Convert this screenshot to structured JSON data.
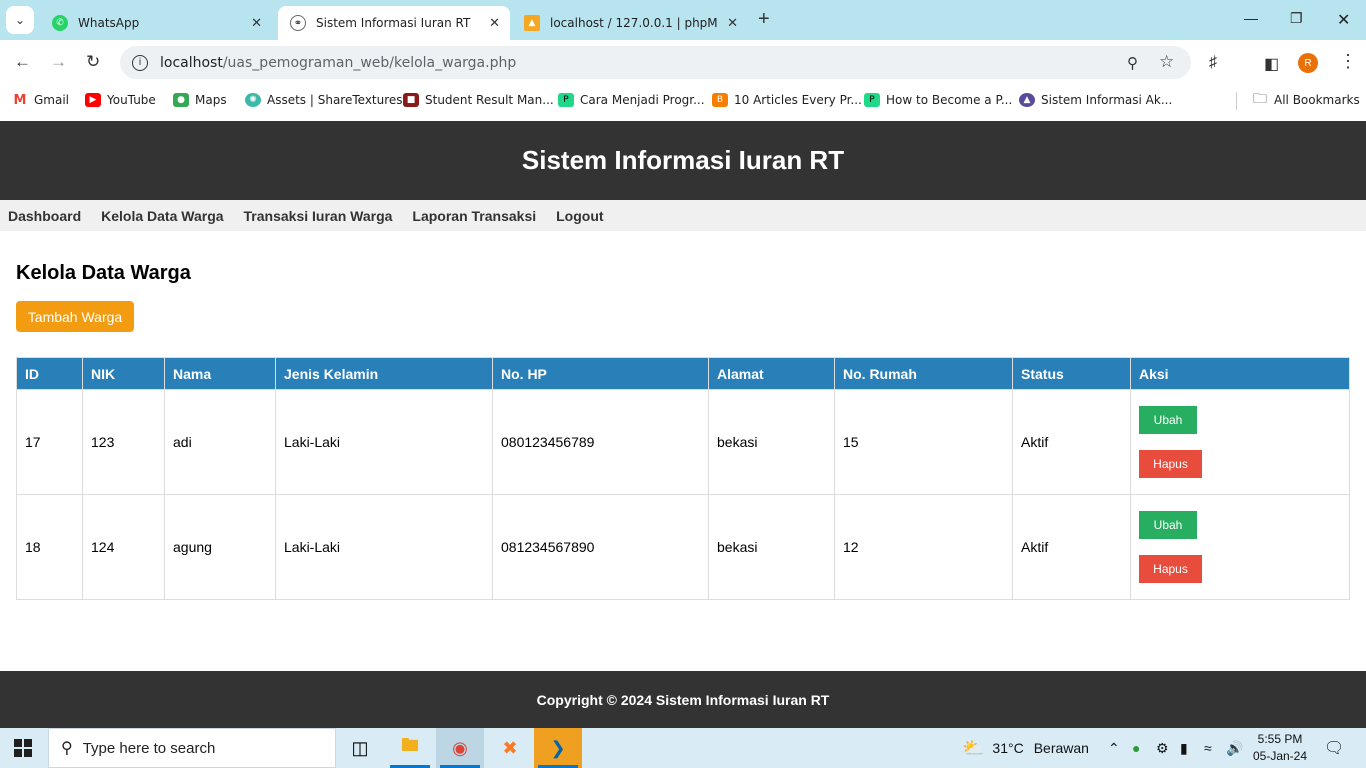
{
  "browser": {
    "tabs": [
      {
        "title": "WhatsApp"
      },
      {
        "title": "Sistem Informasi Iuran RT"
      },
      {
        "title": "localhost / 127.0.0.1 | phpMyAd"
      }
    ],
    "url_host": "localhost",
    "url_path": "/uas_pemograman_web/kelola_warga.php",
    "profile_initial": "R",
    "bookmarks": [
      "Gmail",
      "YouTube",
      "Maps",
      "Assets | ShareTextures",
      "Student Result Man...",
      "Cara Menjadi Progr...",
      "10 Articles Every Pr...",
      "How to Become a P...",
      "Sistem Informasi Ak..."
    ],
    "all_bookmarks": "All Bookmarks"
  },
  "site": {
    "title": "Sistem Informasi Iuran RT",
    "nav": [
      "Dashboard",
      "Kelola Data Warga",
      "Transaksi Iuran Warga",
      "Laporan Transaksi",
      "Logout"
    ],
    "heading": "Kelola Data Warga",
    "add_button": "Tambah Warga",
    "columns": [
      "ID",
      "NIK",
      "Nama",
      "Jenis Kelamin",
      "No. HP",
      "Alamat",
      "No. Rumah",
      "Status",
      "Aksi"
    ],
    "rows": [
      {
        "id": "17",
        "nik": "123",
        "nama": "adi",
        "jk": "Laki-Laki",
        "hp": "080123456789",
        "alamat": "bekasi",
        "rumah": "15",
        "status": "Aktif"
      },
      {
        "id": "18",
        "nik": "124",
        "nama": "agung",
        "jk": "Laki-Laki",
        "hp": "081234567890",
        "alamat": "bekasi",
        "rumah": "12",
        "status": "Aktif"
      }
    ],
    "edit_label": "Ubah",
    "delete_label": "Hapus",
    "footer": "Copyright © 2024 Sistem Informasi Iuran RT"
  },
  "taskbar": {
    "search_placeholder": "Type here to search",
    "weather_temp": "31°C",
    "weather_text": "Berawan",
    "time": "5:55 PM",
    "date": "05-Jan-24"
  },
  "colors": {
    "header_bg": "#333333",
    "table_header": "#2980b9",
    "add_button": "#f39c12",
    "edit_button": "#27ae60",
    "delete_button": "#e74c3c"
  }
}
